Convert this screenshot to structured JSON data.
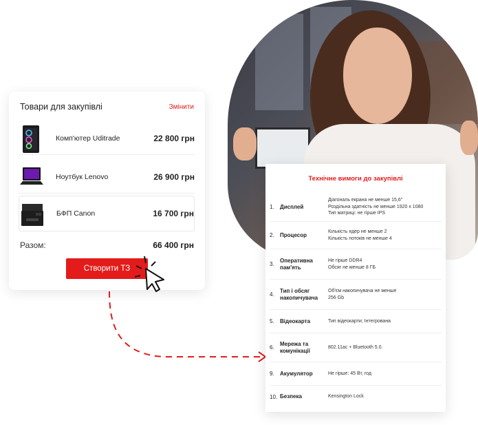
{
  "cart": {
    "title": "Товари для закупівлі",
    "edit_label": "Змінити",
    "items": [
      {
        "name": "Комп'ютер Uditrade",
        "price": "22 800 грн",
        "icon": "pc-tower-icon"
      },
      {
        "name": "Ноутбук Lenovo",
        "price": "26 900 грн",
        "icon": "laptop-icon"
      },
      {
        "name": "БФП Canon",
        "price": "16 700 грн",
        "icon": "printer-icon"
      }
    ],
    "total_label": "Разом:",
    "total_value": "66 400 грн",
    "create_button": "Створити ТЗ"
  },
  "specs": {
    "title": "Технічне вимоги до закупівлі",
    "rows": [
      {
        "num": "1.",
        "name": "Дисплей",
        "value": "Діагональ екрана не менше 15,6\"\nРоздільна здатність не менше 1920 x 1080\nТип матриці: не гірше IPS"
      },
      {
        "num": "2.",
        "name": "Процесор",
        "value": "Кількість ядер не менше 2\nКількість потоків не менше 4"
      },
      {
        "num": "3.",
        "name": "Оперативна пам'ять",
        "value": "Не гірше DDR4\nОбсяг не менше 8 ГБ"
      },
      {
        "num": "4.",
        "name": "Тип і обсяг накопичувача",
        "value": "Об'єм накопичувача не менше\n256 Gb"
      },
      {
        "num": "5.",
        "name": "Відеокарта",
        "value": "Тип відеокарти; Інтегрована"
      },
      {
        "num": "6.",
        "name": "Мережа та комунікації",
        "value": "802.11ac + Bluetooth 5.0."
      },
      {
        "num": "9.",
        "name": "Акумулятор",
        "value": "Не гірше: 45 Вт, год"
      },
      {
        "num": "10.",
        "name": "Безпека",
        "value": "Kensington Lock"
      }
    ]
  },
  "colors": {
    "accent": "#e31b1b"
  }
}
